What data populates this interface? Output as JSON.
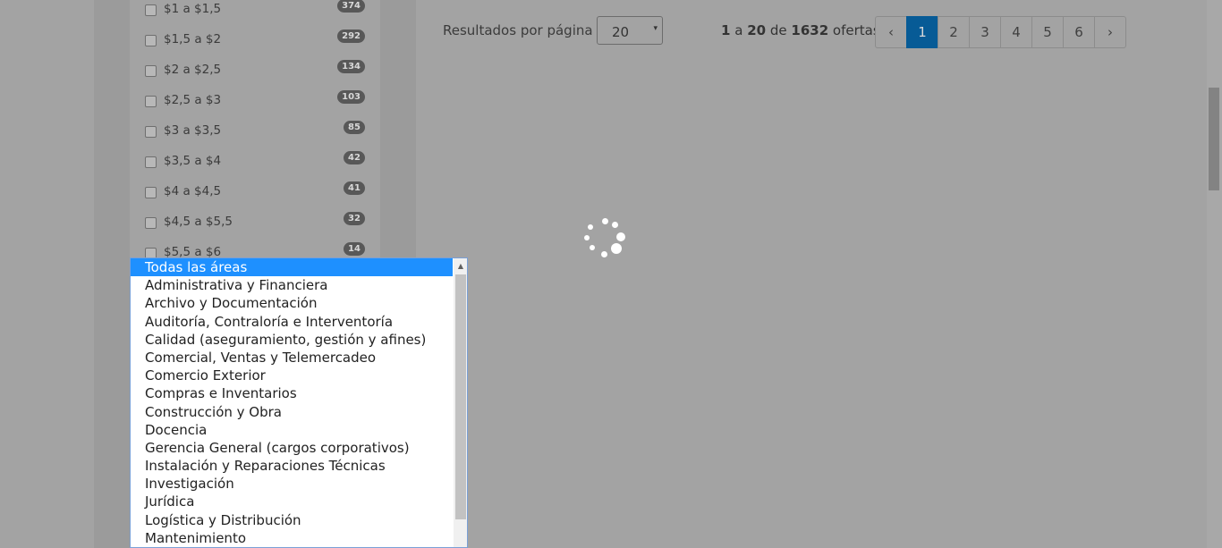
{
  "filters": [
    {
      "label": "$1 a $1,5",
      "count": "374"
    },
    {
      "label": "$1,5 a $2",
      "count": "292"
    },
    {
      "label": "$2 a $2,5",
      "count": "134"
    },
    {
      "label": "$2,5 a $3",
      "count": "103"
    },
    {
      "label": "$3 a $3,5",
      "count": "85"
    },
    {
      "label": "$3,5 a $4",
      "count": "42"
    },
    {
      "label": "$4 a $4,5",
      "count": "41"
    },
    {
      "label": "$4,5 a $5,5",
      "count": "32"
    },
    {
      "label": "$5,5 a $6",
      "count": "14"
    }
  ],
  "toolbar": {
    "results_label": "Resultados por página",
    "per_page_value": "20",
    "caret": "▾",
    "range_start": "1",
    "range_sep": "a",
    "range_end": "20",
    "of_label": "de",
    "total": "1632",
    "unit": "ofertas"
  },
  "pagination": {
    "prev": "‹",
    "pages": [
      "1",
      "2",
      "3",
      "4",
      "5",
      "6"
    ],
    "next": "›",
    "active": "1"
  },
  "dropdown": {
    "up_arrow": "▲",
    "options": [
      "Todas las áreas",
      "Administrativa y Financiera",
      "Archivo y Documentación",
      "Auditoría, Contraloría e Interventoría",
      "Calidad (aseguramiento, gestión y afines)",
      "Comercial, Ventas y Telemercadeo",
      "Comercio Exterior",
      "Compras e Inventarios",
      "Construcción y Obra",
      "Docencia",
      "Gerencia General (cargos corporativos)",
      "Instalación y Reparaciones Técnicas",
      "Investigación",
      "Jurídica",
      "Logística y Distribución",
      "Mantenimiento"
    ],
    "selected": "Todas las áreas"
  },
  "colors": {
    "overlay": "#a3a3a3",
    "active_page": "#075b96",
    "selected_option": "#1e90ff"
  }
}
